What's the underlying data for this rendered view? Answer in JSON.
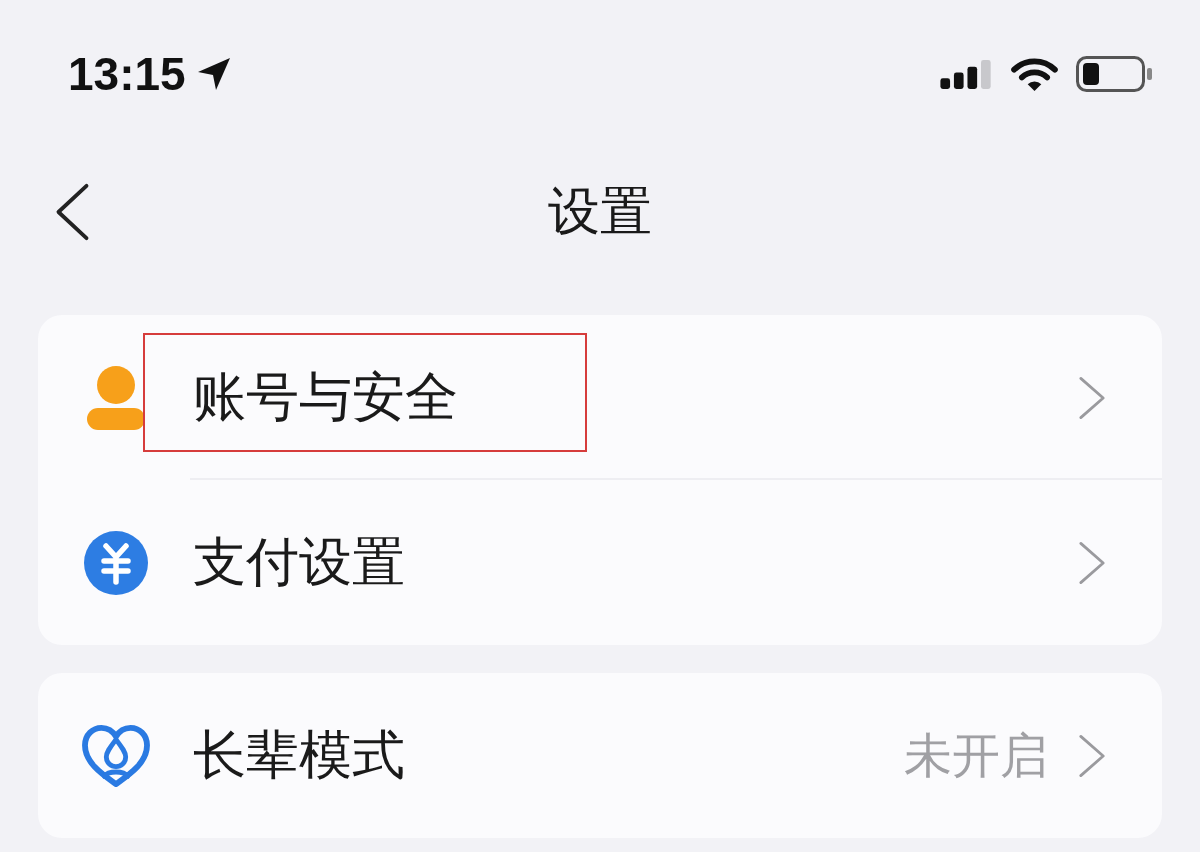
{
  "status_bar": {
    "time": "13:15"
  },
  "nav": {
    "title": "设置"
  },
  "groups": [
    {
      "items": [
        {
          "kind": "account",
          "label": "账号与安全",
          "highlighted": true
        },
        {
          "kind": "payment",
          "label": "支付设置",
          "highlighted": false
        }
      ]
    },
    {
      "items": [
        {
          "kind": "elder",
          "label": "长辈模式",
          "value": "未开启",
          "highlighted": false
        }
      ]
    }
  ]
}
